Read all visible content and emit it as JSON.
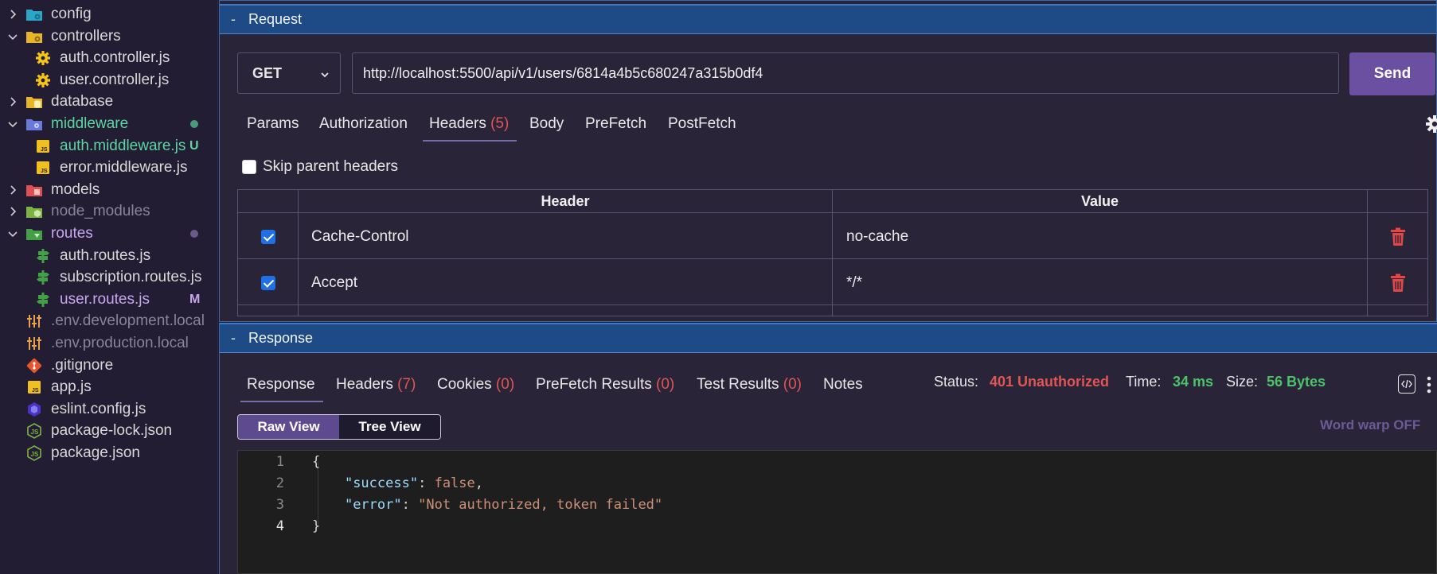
{
  "explorer": {
    "items": [
      {
        "label": "config",
        "icon": "folder-config-icon",
        "kind": "folder",
        "expanded": false,
        "color": "#d8d8d8"
      },
      {
        "label": "controllers",
        "icon": "folder-controllers-icon",
        "kind": "folder",
        "expanded": true,
        "color": "#d8d8d8"
      },
      {
        "label": "auth.controller.js",
        "icon": "gear-file-icon",
        "kind": "file",
        "color": "#d8d8d8"
      },
      {
        "label": "user.controller.js",
        "icon": "gear-file-icon",
        "kind": "file",
        "color": "#d8d8d8"
      },
      {
        "label": "database",
        "icon": "folder-database-icon",
        "kind": "folder",
        "expanded": false,
        "color": "#d8d8d8"
      },
      {
        "label": "middleware",
        "icon": "folder-middleware-icon",
        "kind": "folder",
        "expanded": true,
        "color": "#5cd6a0",
        "status": "dot",
        "status_color": "#4a9a7a"
      },
      {
        "label": "auth.middleware.js",
        "icon": "js-file-icon",
        "kind": "file",
        "color": "#5cd6a0",
        "status": "U",
        "status_color": "#5cd6a0"
      },
      {
        "label": "error.middleware.js",
        "icon": "js-file-icon",
        "kind": "file",
        "color": "#d8d8d8"
      },
      {
        "label": "models",
        "icon": "folder-models-icon",
        "kind": "folder",
        "expanded": false,
        "color": "#d8d8d8"
      },
      {
        "label": "node_modules",
        "icon": "folder-node-icon",
        "kind": "folder",
        "expanded": false,
        "color": "#8a8499"
      },
      {
        "label": "routes",
        "icon": "folder-routes-icon",
        "kind": "folder",
        "expanded": true,
        "color": "#c7a6f0",
        "status": "dot",
        "status_color": "#6a5a8a"
      },
      {
        "label": "auth.routes.js",
        "icon": "signpost-icon",
        "kind": "file",
        "color": "#d8d8d8"
      },
      {
        "label": "subscription.routes.js",
        "icon": "signpost-icon",
        "kind": "file",
        "color": "#d8d8d8"
      },
      {
        "label": "user.routes.js",
        "icon": "signpost-icon",
        "kind": "file",
        "color": "#c7a6f0",
        "status": "M",
        "status_color": "#c7a6f0"
      },
      {
        "label": ".env.development.local",
        "icon": "env-settings-icon",
        "kind": "file",
        "color": "#8a8499"
      },
      {
        "label": ".env.production.local",
        "icon": "env-settings-icon",
        "kind": "file",
        "color": "#8a8499"
      },
      {
        "label": ".gitignore",
        "icon": "git-icon",
        "kind": "file",
        "color": "#d8d8d8"
      },
      {
        "label": "app.js",
        "icon": "js-file-icon",
        "kind": "file",
        "color": "#d8d8d8"
      },
      {
        "label": "eslint.config.js",
        "icon": "eslint-icon",
        "kind": "file",
        "color": "#d8d8d8"
      },
      {
        "label": "package-lock.json",
        "icon": "nodejs-icon",
        "kind": "file",
        "color": "#d8d8d8"
      },
      {
        "label": "package.json",
        "icon": "nodejs-icon",
        "kind": "file",
        "color": "#d8d8d8"
      }
    ]
  },
  "request": {
    "panel_title": "Request",
    "toggle": "-",
    "method": "GET",
    "url": "http://localhost:5500/api/v1/users/6814a4b5c680247a315b0df4",
    "send_label": "Send",
    "tabs": [
      {
        "label": "Params",
        "count": ""
      },
      {
        "label": "Authorization",
        "count": ""
      },
      {
        "label": "Headers",
        "count": "(5)"
      },
      {
        "label": "Body",
        "count": ""
      },
      {
        "label": "PreFetch",
        "count": ""
      },
      {
        "label": "PostFetch",
        "count": ""
      }
    ],
    "active_tab": "Headers",
    "skip_parent_label": "Skip parent headers",
    "headers_table": {
      "col_header": "Header",
      "col_value": "Value",
      "rows": [
        {
          "enabled": true,
          "header": "Cache-Control",
          "value": "no-cache"
        },
        {
          "enabled": true,
          "header": "Accept",
          "value": "*/*"
        }
      ]
    }
  },
  "response": {
    "panel_title": "Response",
    "toggle": "-",
    "tabs": [
      {
        "label": "Response",
        "count": ""
      },
      {
        "label": "Headers",
        "count": "(7)"
      },
      {
        "label": "Cookies",
        "count": "(0)"
      },
      {
        "label": "PreFetch Results",
        "count": "(0)"
      },
      {
        "label": "Test Results",
        "count": "(0)"
      },
      {
        "label": "Notes",
        "count": ""
      }
    ],
    "active_tab": "Response",
    "status_label": "Status:",
    "status_value": "401 Unauthorized",
    "time_label": "Time:",
    "time_value": "34 ms",
    "size_label": "Size:",
    "size_value": "56 Bytes",
    "raw_view": "Raw View",
    "tree_view": "Tree View",
    "word_wrap": "Word warp OFF",
    "code_lines": [
      {
        "num": "1",
        "text": "{"
      },
      {
        "num": "2",
        "text": "    \"success\": false,"
      },
      {
        "num": "3",
        "text": "    \"error\": \"Not authorized, token failed\""
      },
      {
        "num": "4",
        "text": "}"
      }
    ]
  },
  "colors": {
    "accent_purple": "#6b4fa1",
    "panel_bar_blue": "#1e4a86",
    "error_red": "#e05555",
    "success_green": "#4cc36b"
  }
}
